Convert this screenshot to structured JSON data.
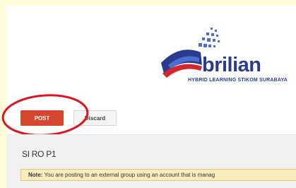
{
  "logo": {
    "name": "brilian",
    "tagline": "HYBRID LEARNING STIKOM SURABAYA"
  },
  "actions": {
    "post_label": "POST",
    "discard_label": "Discard"
  },
  "group": {
    "name": "SI RO P1"
  },
  "note": {
    "label": "Note:",
    "text": "You are posting to an external group using an account that is manag"
  },
  "colors": {
    "post_button": "#d6462f",
    "annotation_circle": "#e0141e",
    "note_background": "#f9edbe",
    "logo_blue": "#2a3b8f"
  }
}
